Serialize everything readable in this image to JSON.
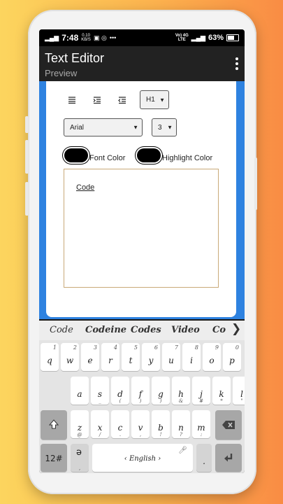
{
  "status_bar": {
    "time": "7:48",
    "speed_value": "0.10",
    "speed_unit": "KB/S",
    "network": "Vo) 4G",
    "network_sub": "LTE",
    "battery": "63%"
  },
  "app_bar": {
    "title": "Text Editor",
    "subtitle": "Preview"
  },
  "toolbar": {
    "heading_select": "H1",
    "font_select": "Arial",
    "size_select": "3",
    "font_color_label": "Font Color",
    "highlight_color_label": "Highlight Color"
  },
  "editor": {
    "content": "Code"
  },
  "keyboard": {
    "suggestions": [
      "Code",
      "Codeine",
      "Codes",
      "Video",
      "Co"
    ],
    "row1": [
      {
        "key": "q",
        "num": "1"
      },
      {
        "key": "w",
        "num": "2"
      },
      {
        "key": "e",
        "num": "3"
      },
      {
        "key": "r",
        "num": "4"
      },
      {
        "key": "t",
        "num": "5"
      },
      {
        "key": "y",
        "num": "6"
      },
      {
        "key": "u",
        "num": "7"
      },
      {
        "key": "i",
        "num": "8"
      },
      {
        "key": "o",
        "num": "9"
      },
      {
        "key": "p",
        "num": "0"
      }
    ],
    "row2": [
      {
        "key": "a",
        "sym": ""
      },
      {
        "key": "s",
        "sym": "_"
      },
      {
        "key": "d",
        "sym": "("
      },
      {
        "key": "f",
        "sym": ")"
      },
      {
        "key": "g",
        "sym": ")"
      },
      {
        "key": "h",
        "sym": "&"
      },
      {
        "key": "j",
        "sym": "#"
      },
      {
        "key": "k",
        "sym": "*"
      },
      {
        "key": "l",
        "sym": "\""
      }
    ],
    "row3": [
      {
        "key": "z",
        "sym": "@"
      },
      {
        "key": "x",
        "sym": "/"
      },
      {
        "key": "c",
        "sym": "."
      },
      {
        "key": "v",
        "sym": ","
      },
      {
        "key": "b",
        "sym": "!"
      },
      {
        "key": "n",
        "sym": "?"
      },
      {
        "key": "m",
        "sym": ":"
      }
    ],
    "symbols_key": "12#",
    "comma_key": ",",
    "space_label": "English",
    "period_key": "."
  },
  "colors": {
    "accent": "#2e82e0",
    "appbar": "#222222",
    "editor_border": "#c9a978"
  }
}
